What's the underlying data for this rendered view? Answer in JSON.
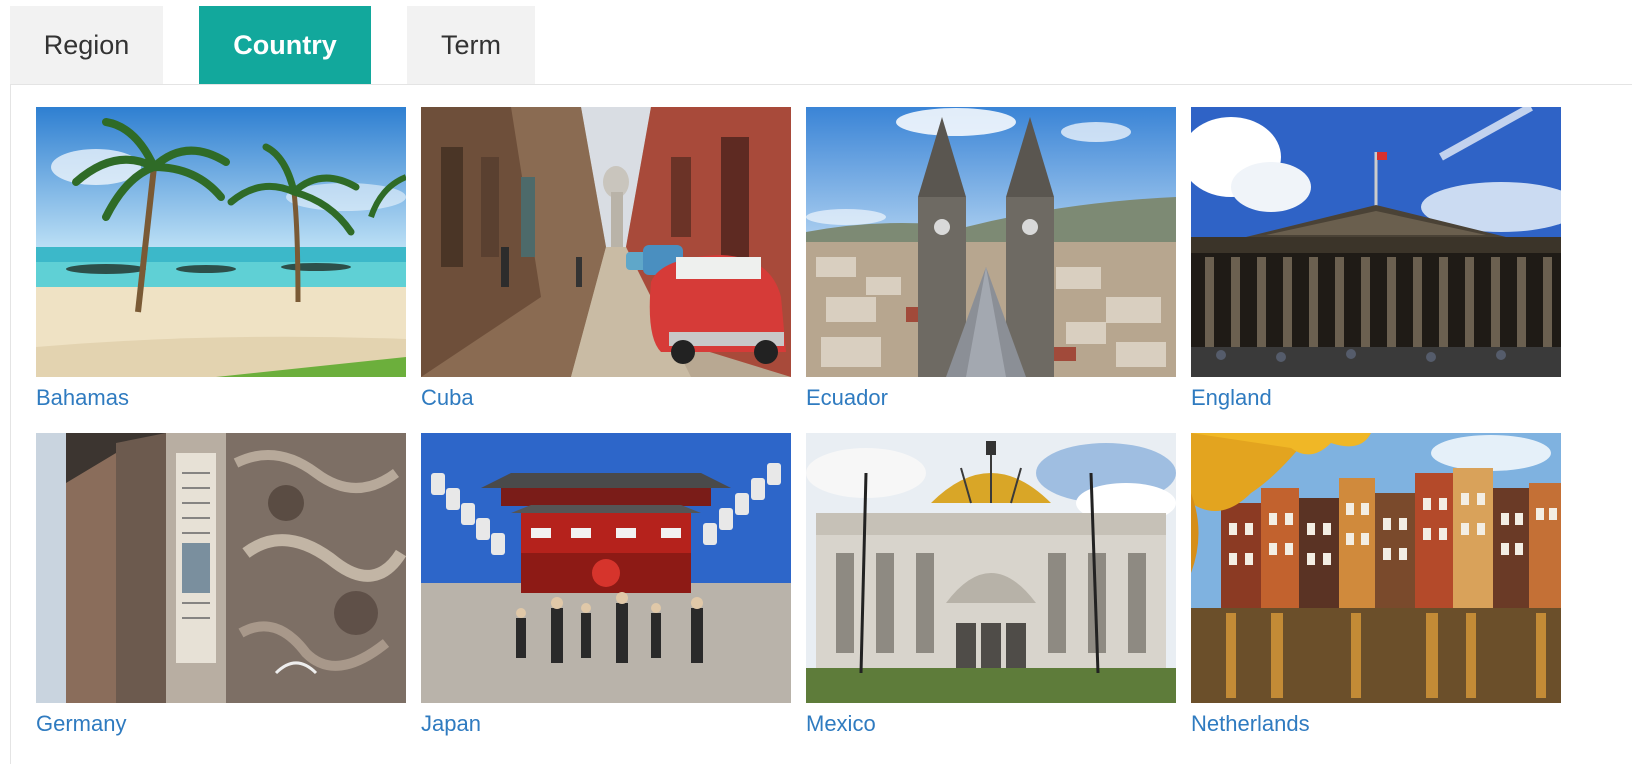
{
  "tabs": [
    {
      "label": "Region",
      "active": false
    },
    {
      "label": "Country",
      "active": true
    },
    {
      "label": "Term",
      "active": false
    }
  ],
  "colors": {
    "accent": "#12a89c",
    "link": "#2f7bc0",
    "tab_inactive": "#f2f2f2"
  },
  "countries": [
    {
      "name": "Bahamas",
      "image": "beach-palms-photo"
    },
    {
      "name": "Cuba",
      "image": "havana-street-classic-car-photo"
    },
    {
      "name": "Ecuador",
      "image": "basilica-towers-quito-photo"
    },
    {
      "name": "England",
      "image": "british-museum-facade-photo"
    },
    {
      "name": "Germany",
      "image": "berlin-wall-graffiti-photo"
    },
    {
      "name": "Japan",
      "image": "asakusa-temple-gate-photo"
    },
    {
      "name": "Mexico",
      "image": "palacio-bellas-artes-photo"
    },
    {
      "name": "Netherlands",
      "image": "amsterdam-canal-houses-photo"
    }
  ]
}
